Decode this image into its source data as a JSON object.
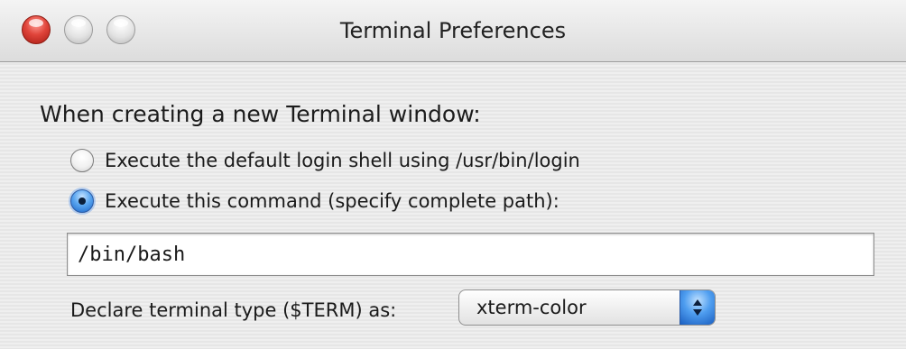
{
  "window": {
    "title": "Terminal Preferences"
  },
  "title_bar_buttons": {
    "close": "close-button",
    "minimize": "minimize-button",
    "zoom": "zoom-button"
  },
  "section": {
    "heading": "When creating a new Terminal window:"
  },
  "shell_options": [
    {
      "label": "Execute the default login shell using /usr/bin/login",
      "selected": false
    },
    {
      "label": "Execute this command (specify complete path):",
      "selected": true
    }
  ],
  "command_field": {
    "value": "/bin/bash"
  },
  "terminal_type": {
    "label": "Declare terminal type ($TERM) as:",
    "selected": "xterm-color"
  },
  "colors": {
    "close_button": "#e0443a",
    "selection_accent": "#3b86e0"
  }
}
